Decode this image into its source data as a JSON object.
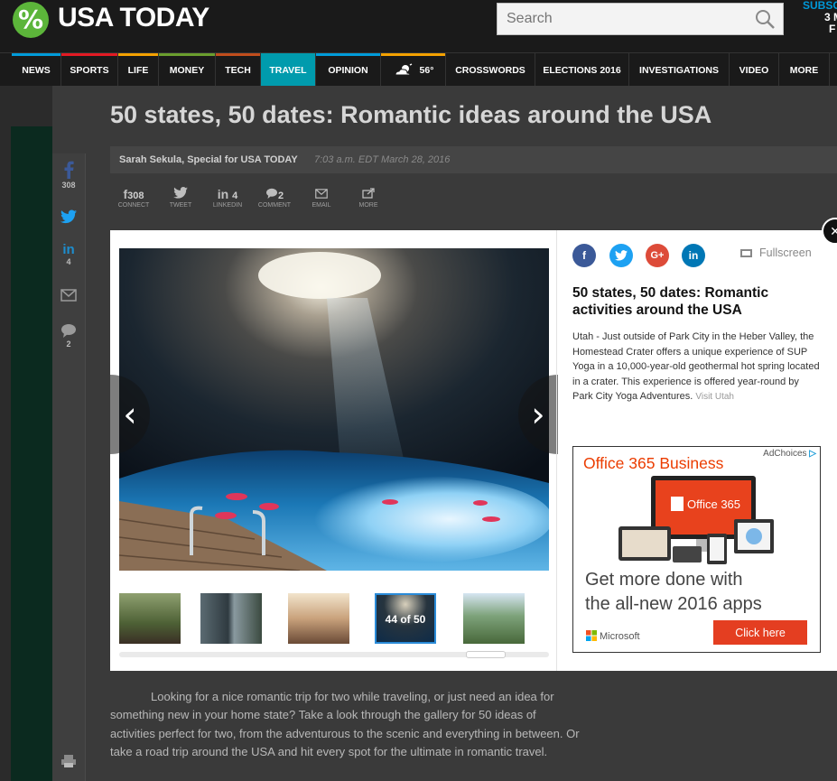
{
  "brand": {
    "logo_symbol": "%",
    "name": "USA TODAY",
    "color": "#5cb53a"
  },
  "search": {
    "placeholder": "Search"
  },
  "subscribe": {
    "line1": "SUBSC",
    "line2": "3 M",
    "line3": "F"
  },
  "nav": {
    "items": [
      {
        "label": "NEWS",
        "color": "#009bd9"
      },
      {
        "label": "SPORTS",
        "color": "#e21a23"
      },
      {
        "label": "LIFE",
        "color": "#f4a100"
      },
      {
        "label": "MONEY",
        "color": "#6a9e2e"
      },
      {
        "label": "TECH",
        "color": "#c04d1c"
      },
      {
        "label": "TRAVEL",
        "color": "#009bad"
      },
      {
        "label": "OPINION",
        "color": "#009bd9"
      },
      {
        "label": "56°",
        "color": "#f4a100"
      },
      {
        "label": "CROSSWORDS",
        "color": "#555555"
      },
      {
        "label": "ELECTIONS 2016",
        "color": "#555555"
      },
      {
        "label": "INVESTIGATIONS",
        "color": "#555555"
      },
      {
        "label": "VIDEO",
        "color": "#555555"
      },
      {
        "label": "MORE",
        "color": "#555555"
      }
    ]
  },
  "article": {
    "headline": "50 states, 50 dates: Romantic ideas around the USA",
    "byline": "Sarah Sekula, Special for USA TODAY",
    "timestamp": "7:03 a.m. EDT March 28, 2016",
    "body": "Looking for a nice romantic trip for two while traveling, or just need an idea for something new in your home state? Take a look through the gallery for 50 ideas of activities perfect for two, from the adventurous to the scenic and everything in between. Or take a road trip around the USA and hit every spot for the ultimate in romantic travel."
  },
  "share_sidebar": {
    "facebook_count": "308",
    "linkedin_count": "4",
    "comment_count": "2"
  },
  "share_row": [
    {
      "icon": "facebook-icon",
      "value": "308",
      "label": "CONNECT"
    },
    {
      "icon": "twitter-icon",
      "value": "",
      "label": "TWEET"
    },
    {
      "icon": "linkedin-icon",
      "value": "4",
      "label": "LINKEDIN"
    },
    {
      "icon": "comment-icon",
      "value": "2",
      "label": "COMMENT"
    },
    {
      "icon": "email-icon",
      "value": "",
      "label": "EMAIL"
    },
    {
      "icon": "share-icon",
      "value": "",
      "label": "MORE"
    }
  ],
  "gallery": {
    "fullscreen_label": "Fullscreen",
    "caption_title": "50 states, 50 dates: Romantic activities around the USA",
    "caption_text": "Utah - Just outside of Park City in the Heber Valley, the Homestead Crater offers a unique experience of SUP Yoga in a 10,000-year-old geothermal hot spring located in a crater. This experience is offered year-round by Park City Yoga Adventures.",
    "caption_credit": "Visit Utah",
    "counter": "44 of 50",
    "social_colors": {
      "facebook": "#3b5998",
      "twitter": "#1da1f2",
      "google": "#dd4b39",
      "linkedin": "#0077b5"
    }
  },
  "ad": {
    "adchoices": "AdChoices",
    "title": "Office 365 Business",
    "product": "Office 365",
    "tagline_1": "Get more done with",
    "tagline_2": "the all-new 2016 apps",
    "vendor": "Microsoft",
    "cta": "Click here"
  }
}
